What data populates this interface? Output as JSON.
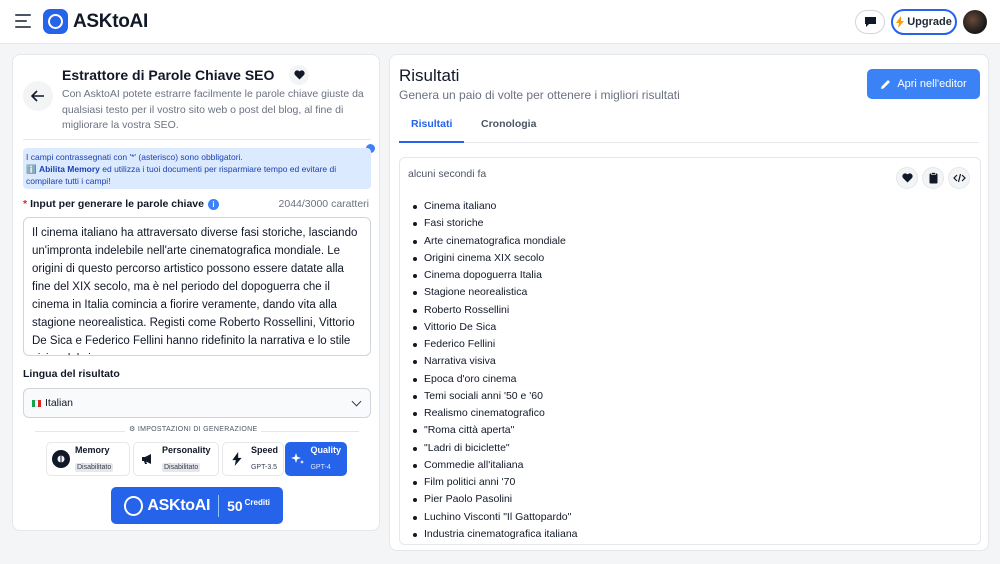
{
  "header": {
    "brand": "ASKtoAI",
    "upgrade_label": "Upgrade",
    "menu_icon": "hamburger-icon",
    "chat_icon": "chat-bubble-icon",
    "upgrade_icon": "lightning-icon"
  },
  "tool": {
    "title": "Estrattore di Parole Chiave SEO",
    "description": "Con AsktoAI potete estrarre facilmente le parole chiave giuste da qualsiasi testo per il vostro sito web o post del blog, al fine di migliorare la vostra SEO.",
    "notice_line1": "I campi contrassegnati con '*' (asterisco) sono obbligatori.",
    "notice_bold": "Abilita Memory",
    "notice_line2": " ed utilizza i tuoi documenti per risparmiare tempo ed evitare di compilare tutti i campi!",
    "input_label": "Input per generare le parole chiave",
    "required_mark": "*",
    "char_counter": "2044/3000 caratteri",
    "input_value": "Il cinema italiano ha attraversato diverse fasi storiche, lasciando un'impronta indelebile nell'arte cinematografica mondiale. Le origini di questo percorso artistico possono essere datate alla fine del XIX secolo, ma è nel periodo del dopoguerra che il cinema in Italia comincia a fiorire veramente, dando vita alla stagione neorealistica. Registi come Roberto Rossellini, Vittorio De Sica e Federico Fellini hanno ridefinito la narrativa e lo stile visivo del cinema",
    "language_label": "Lingua del risultato",
    "language_value": "Italian",
    "settings_title": "IMPOSTAZIONI DI GENERAZIONE",
    "options": [
      {
        "label": "Memory",
        "sub": "Disabilitato",
        "icon": "brain-icon"
      },
      {
        "label": "Personality",
        "sub": "Disabilitato",
        "icon": "megaphone-icon"
      },
      {
        "label": "Speed",
        "sub": "GPT-3.5",
        "icon": "lightning-icon"
      },
      {
        "label": "Quality",
        "sub": "GPT-4",
        "icon": "sparkles-icon",
        "selected": true
      }
    ],
    "run_brand": "ASKtoAI",
    "run_credits": "50",
    "run_credits_label": "Crediti"
  },
  "results": {
    "title": "Risultati",
    "subtitle": "Genera un paio di volte per ottenere i migliori risultati",
    "editor_button": "Apri nell'editor",
    "tabs": [
      "Risultati",
      "Cronologia"
    ],
    "timestamp": "alcuni secondi fa",
    "keywords": [
      "Cinema italiano",
      "Fasi storiche",
      "Arte cinematografica mondiale",
      "Origini cinema XIX secolo",
      "Cinema dopoguerra Italia",
      "Stagione neorealistica",
      "Roberto Rossellini",
      "Vittorio De Sica",
      "Federico Fellini",
      "Narrativa visiva",
      "Epoca d'oro cinema",
      "Temi sociali anni '50 e '60",
      "Realismo cinematografico",
      "\"Roma città aperta\"",
      "\"Ladri di biciclette\"",
      "Commedie all'italiana",
      "Film politici anni '70",
      "Pier Paolo Pasolini",
      "Luchino Visconti \"Il Gattopardo\"",
      "Industria cinematografica italiana"
    ]
  },
  "colors": {
    "accent": "#2563eb",
    "notice_bg": "#dbeafe",
    "button": "#3b82f6"
  }
}
